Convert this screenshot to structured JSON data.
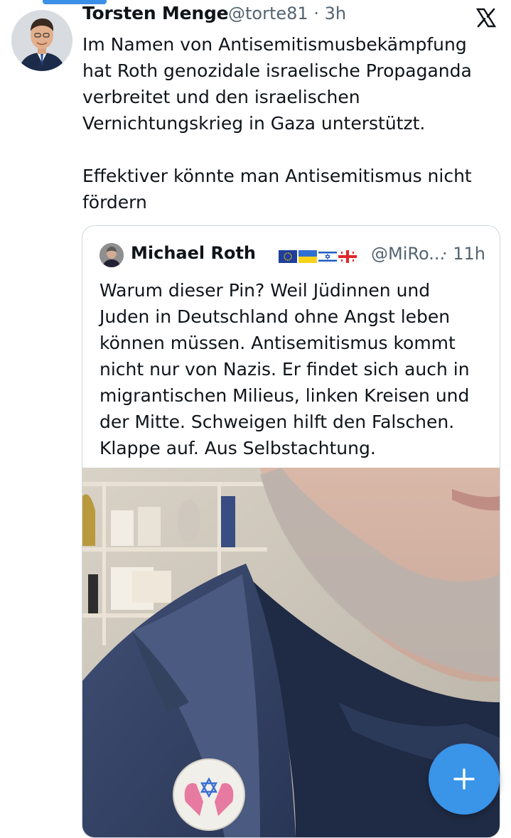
{
  "tweet": {
    "author_name": "Torsten Menge",
    "author_handle_time": "@torte81 · 3h",
    "text": "Im Namen von Antisemitismusbekämpfung\nhat Roth genozidale israelische Propaganda\nverbreitet und den israelischen\nVernichtungskrieg in Gaza unterstützt.\n\nEffektiver könnte man Antisemitismus nicht\nfördern"
  },
  "quoted": {
    "author_name": "Michael Roth",
    "flags": [
      "eu-flag-icon",
      "ukraine-flag-icon",
      "israel-flag-icon",
      "georgia-flag-icon"
    ],
    "handle": "@MiRo...",
    "time": "· 11h",
    "text": "Warum dieser Pin? Weil Jüdinnen und\nJuden in Deutschland ohne Angst leben\nkönnen müssen. Antisemitismus kommt\nnicht nur von Nazis. Er findet sich auch in\nmigrantischen Milieus, linken Kreisen und\nder Mitte. Schweigen hilft den Falschen.\nKlappe auf. Aus Selbstachtung."
  },
  "icons": {
    "platform": "x-logo-icon",
    "compose": "plus-icon"
  },
  "colors": {
    "accent": "#3a94e8",
    "text": "#0f1419",
    "secondary_text": "#536471"
  }
}
